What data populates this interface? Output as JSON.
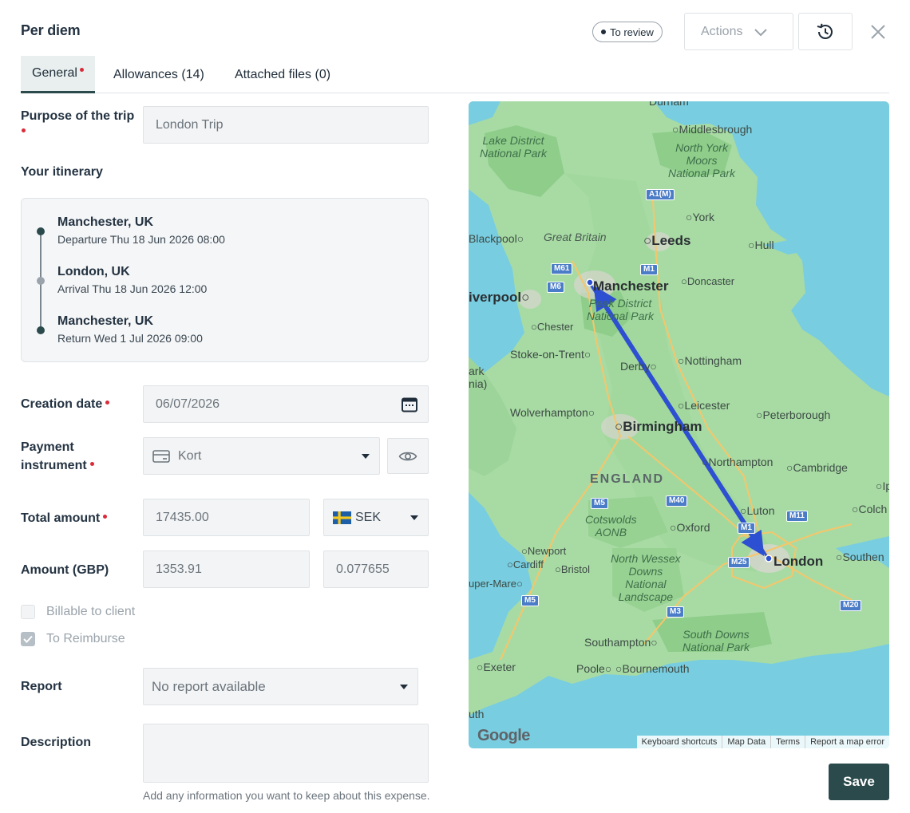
{
  "header": {
    "title": "Per diem",
    "status": "To review",
    "actions_label": "Actions"
  },
  "tabs": [
    {
      "label": "General",
      "required": true,
      "active": true
    },
    {
      "label": "Allowances (14)"
    },
    {
      "label": "Attached files (0)"
    }
  ],
  "form": {
    "purpose_label": "Purpose of the trip",
    "purpose_value": "London Trip",
    "itinerary_label": "Your itinerary",
    "itinerary": [
      {
        "city": "Manchester, UK",
        "detail": "Departure Thu 18 Jun 2026 08:00"
      },
      {
        "city": "London, UK",
        "detail": "Arrival Thu 18 Jun 2026 12:00"
      },
      {
        "city": "Manchester, UK",
        "detail": "Return Wed 1 Jul 2026 09:00"
      }
    ],
    "creation_date_label": "Creation date",
    "creation_date_value": "06/07/2026",
    "payment_label": "Payment instrument",
    "payment_value": "Kort",
    "total_label": "Total amount",
    "total_value": "17435.00",
    "currency_value": "SEK",
    "amount_gbp_label": "Amount (GBP)",
    "amount_gbp_value": "1353.91",
    "rate_value": "0.077655",
    "billable_label": "Billable to client",
    "billable_checked": false,
    "reimburse_label": "To Reimburse",
    "reimburse_checked": true,
    "report_label": "Report",
    "report_value": "No report available",
    "description_label": "Description",
    "description_value": "",
    "description_help": "Add any information you want to keep about this expense."
  },
  "map": {
    "labels": {
      "durham": "Durham",
      "middlesbrough": "Middlesbrough",
      "lake_district": "Lake District\nNational Park",
      "north_york": "North York\nMoors\nNational Park",
      "york": "York",
      "blackpool": "Blackpool",
      "great_britain": "Great Britain",
      "leeds": "Leeds",
      "hull": "Hull",
      "liverpool": "iverpool",
      "manchester": "Manchester",
      "doncaster": "Doncaster",
      "peak_district": "Peak District\nNational Park",
      "chester": "Chester",
      "stoke": "Stoke-on-Trent",
      "derby": "Derby",
      "nottingham": "Nottingham",
      "park_edge": "ark\nnia)",
      "wolverhampton": "Wolverhampton",
      "leicester": "Leicester",
      "peterborough": "Peterborough",
      "birmingham": "Birmingham",
      "northampton": "Northampton",
      "cambridge": "Cambridge",
      "england": "ENGLAND",
      "cotswolds": "Cotswolds\nAONB",
      "oxford": "Oxford",
      "luton": "Luton",
      "colchester": "Colch",
      "ipswich": "Ip",
      "newport": "Newport",
      "cardiff": "Cardiff",
      "bristol": "Bristol",
      "north_wessex": "North Wessex\nDowns\nNational\nLandscape",
      "london": "London",
      "southend": "Southen",
      "weston": "uper-Mare",
      "southampton": "Southampton",
      "south_downs": "South Downs\nNational Park",
      "exeter": "Exeter",
      "poole": "Poole",
      "bournemouth": "Bournemouth",
      "plymouth": "uth"
    },
    "roads": {
      "a1m": "A1(M)",
      "m61": "M61",
      "m6": "M6",
      "m1": "M1",
      "m5a": "M5",
      "m40": "M40",
      "m11": "M11",
      "m1b": "M1",
      "m25": "M25",
      "m3": "M3",
      "m5b": "M5",
      "m20": "M20"
    },
    "provider": "Google",
    "attribution": [
      "Keyboard shortcuts",
      "Map Data",
      "Terms",
      "Report a map error"
    ]
  },
  "footer": {
    "save_label": "Save"
  }
}
